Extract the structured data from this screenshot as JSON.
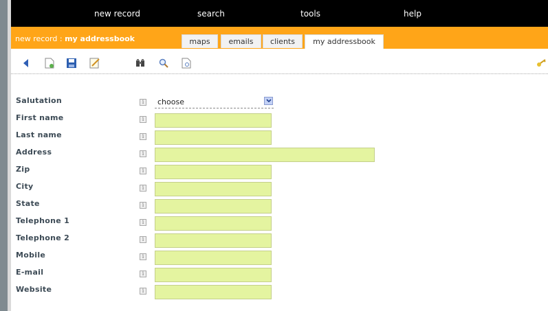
{
  "nav": {
    "new_record": "new record",
    "search": "search",
    "tools": "tools",
    "help": "help"
  },
  "breadcrumb": {
    "prefix": "new record :",
    "current": "my addressbook"
  },
  "tabs": [
    "maps",
    "emails",
    "clients",
    "my addressbook"
  ],
  "toolbar_icons": [
    "back-arrow-icon",
    "new-document-icon",
    "save-disk-icon",
    "edit-icon",
    "binoculars-icon",
    "magnifier-icon",
    "preview-page-icon",
    "keys-icon"
  ],
  "form": {
    "salutation": {
      "label": "Salutation",
      "value": "choose"
    },
    "fields": [
      {
        "label": "First name"
      },
      {
        "label": "Last name"
      },
      {
        "label": "Address"
      },
      {
        "label": "Zip"
      },
      {
        "label": "City"
      },
      {
        "label": "State"
      },
      {
        "label": "Telephone 1"
      },
      {
        "label": "Telephone 2"
      },
      {
        "label": "Mobile"
      },
      {
        "label": "E-mail"
      },
      {
        "label": "Website"
      }
    ],
    "info_glyph": "i"
  },
  "colors": {
    "topbar": "#000000",
    "orangebar": "#ffa518",
    "field_bg": "#e4f4a0"
  }
}
